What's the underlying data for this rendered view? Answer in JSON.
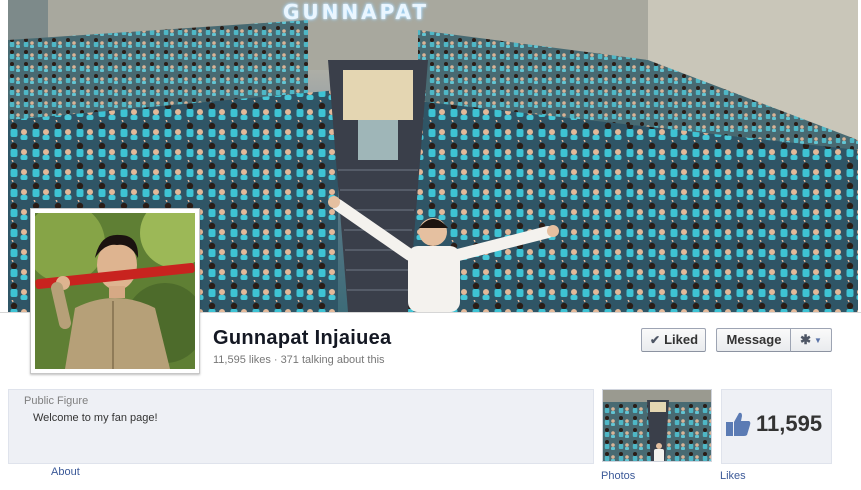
{
  "cover": {
    "sign_text": "GUNNAPAT",
    "description_icon": "crowd-cover-photo"
  },
  "profile": {
    "name": "Gunnapat Injaiuea",
    "likes_text": "11,595 likes",
    "separator": "·",
    "talking_text": "371 talking about this"
  },
  "actions": {
    "liked_label": "Liked",
    "liked_icon": "check-icon",
    "message_label": "Message",
    "settings_icon": "gear-icon",
    "dropdown_icon": "caret-down-icon"
  },
  "info": {
    "category": "Public Figure",
    "description": "Welcome to my fan page!",
    "about_link": "About"
  },
  "tiles": {
    "photos_label": "Photos",
    "likes_count": "11,595",
    "likes_label": "Likes",
    "likes_icon": "thumbs-up-icon"
  },
  "colors": {
    "link": "#3b5998",
    "name": "#141823",
    "muted": "#777777",
    "shirt_teal": "#2fb5c8"
  }
}
